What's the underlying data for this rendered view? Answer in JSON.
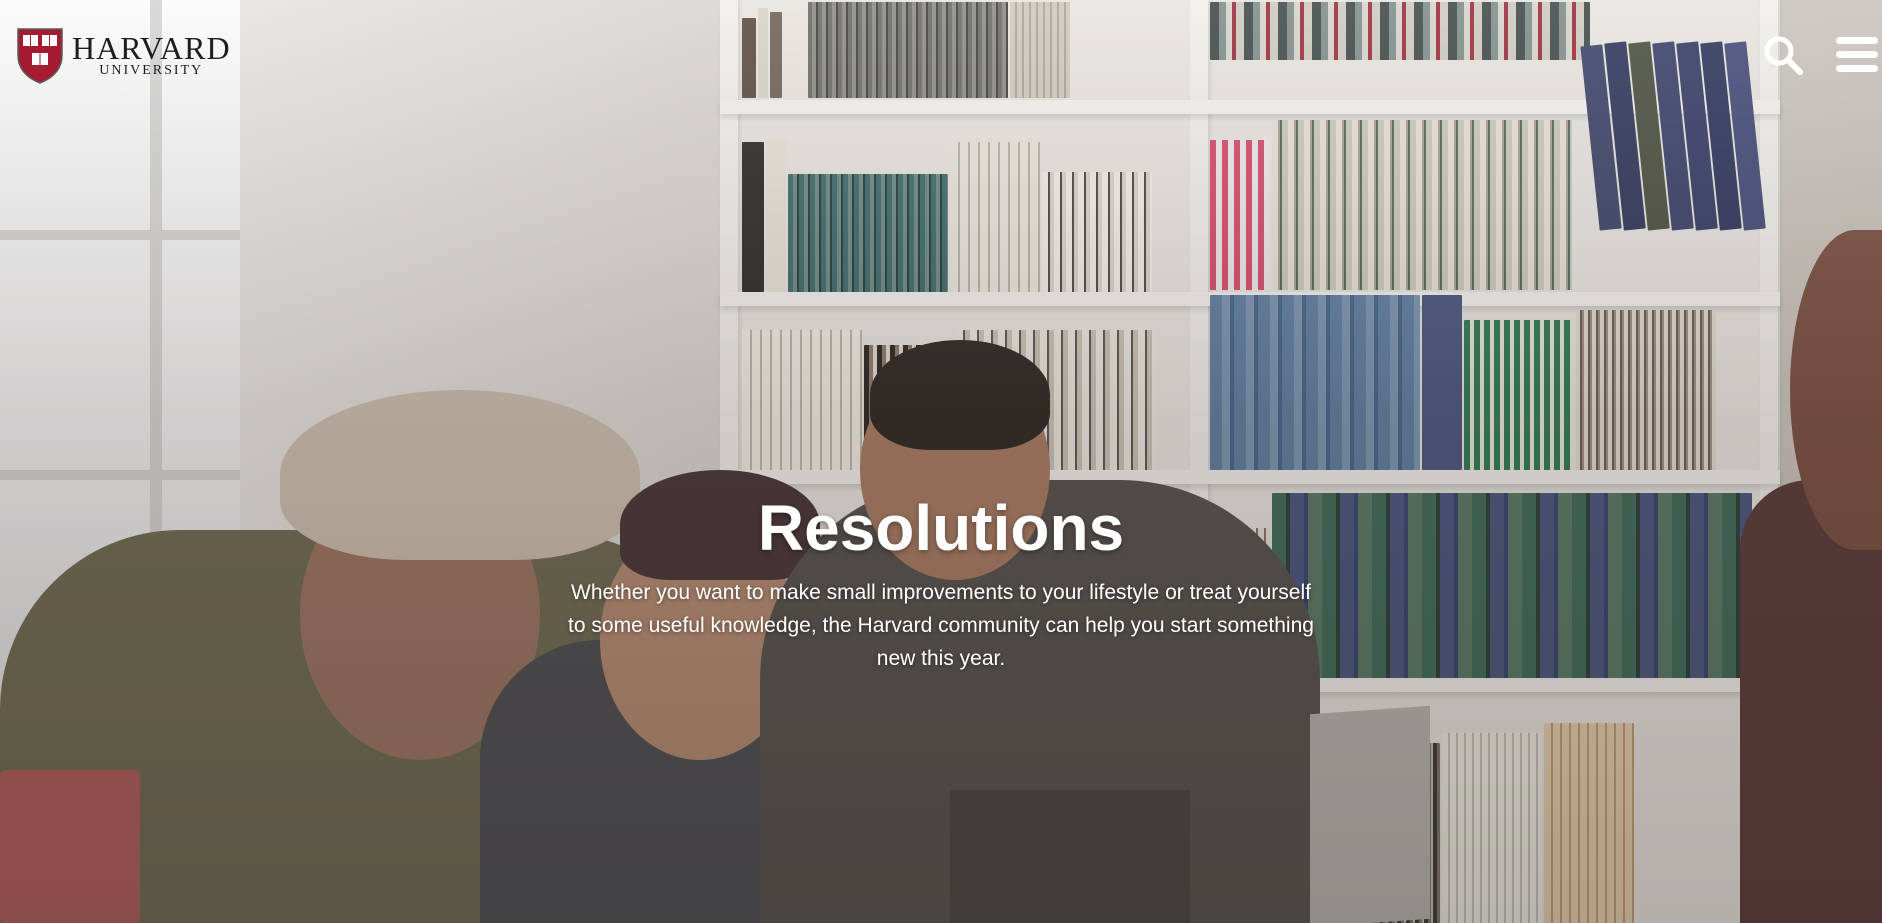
{
  "header": {
    "logo": {
      "wordmark_primary": "HARVARD",
      "wordmark_secondary": "UNIVERSITY",
      "shield_icon": "harvard-veritas-shield-icon"
    },
    "icons": {
      "search": "search-icon",
      "menu": "hamburger-menu-icon"
    }
  },
  "hero": {
    "title": "Resolutions",
    "description": "Whether you want to make small improvements to your lifestyle or treat yourself to some useful knowledge, the Harvard community can help you start something new this year."
  },
  "colors": {
    "harvard_crimson": "#a51c30",
    "hero_text": "#ffffff",
    "header_icons": "#ffffff",
    "wordmark": "#1e1e1e"
  }
}
